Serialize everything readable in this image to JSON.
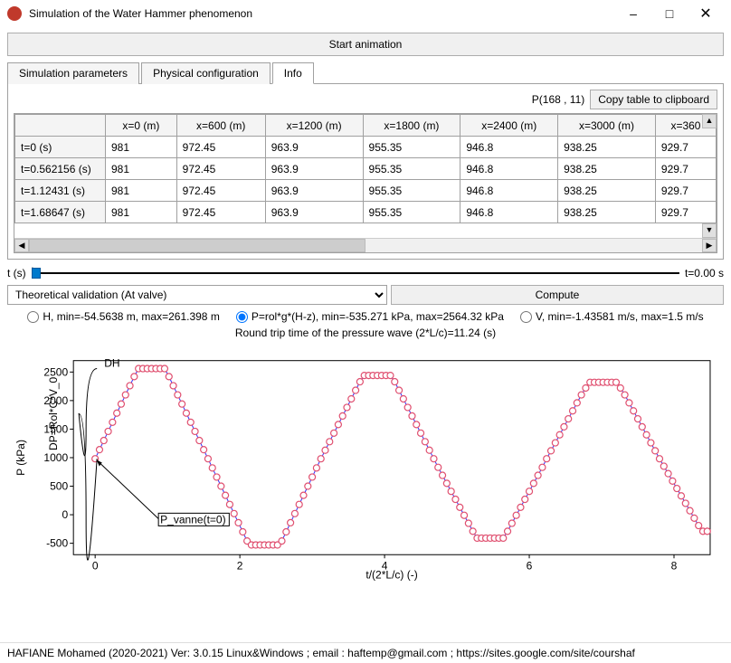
{
  "window": {
    "title": "Simulation of the Water Hammer phenomenon"
  },
  "start_button": "Start animation",
  "tabs": [
    {
      "label": "Simulation parameters"
    },
    {
      "label": "Physical configuration"
    },
    {
      "label": "Info"
    }
  ],
  "active_tab": 2,
  "info": {
    "pointer": "P(168 , 11)",
    "copy_button": "Copy table to clipboard",
    "table": {
      "col_headers": [
        "",
        "x=0 (m)",
        "x=600 (m)",
        "x=1200 (m)",
        "x=1800 (m)",
        "x=2400 (m)",
        "x=3000 (m)",
        "x=360"
      ],
      "row_headers": [
        "t=0 (s)",
        "t=0.562156 (s)",
        "t=1.12431 (s)",
        "t=1.68647 (s)"
      ],
      "cells": [
        [
          "981",
          "972.45",
          "963.9",
          "955.35",
          "946.8",
          "938.25",
          "929.7"
        ],
        [
          "981",
          "972.45",
          "963.9",
          "955.35",
          "946.8",
          "938.25",
          "929.7"
        ],
        [
          "981",
          "972.45",
          "963.9",
          "955.35",
          "946.8",
          "938.25",
          "929.7"
        ],
        [
          "981",
          "972.45",
          "963.9",
          "955.35",
          "946.8",
          "938.25",
          "929.7"
        ]
      ]
    }
  },
  "time": {
    "label": "t (s)",
    "value": "t=0.00 s"
  },
  "dropdown": {
    "selected": "Theoretical validation (At valve)"
  },
  "compute_button": "Compute",
  "radios": {
    "h": "H, min=-54.5638 m, max=261.398 m",
    "p": "P=rol*g*(H-z), min=-535.271 kPa, max=2564.32 kPa",
    "v": "V, min=-1.43581 m/s, max=1.5 m/s",
    "selected": "p"
  },
  "round_trip": "Round trip time of the pressure wave (2*L/c)=11.24 (s)",
  "chart_data": {
    "type": "line",
    "title": "",
    "xlabel": "t/(2*L/c) (-)",
    "ylabel": "P (kPa)",
    "xlim": [
      -0.3,
      8.5
    ],
    "ylim": [
      -700,
      2700
    ],
    "yticks": [
      -500,
      0,
      500,
      1000,
      1500,
      2000,
      2500
    ],
    "xticks": [
      0,
      2,
      4,
      6,
      8
    ],
    "annotations": {
      "dh": "DH",
      "dp": "DP=Rol*C*V_0",
      "p0": "P_vanne(t=0)"
    },
    "series": [
      {
        "name": "P",
        "color": "#3030ff",
        "x": [
          0.0,
          0.06,
          0.12,
          0.18,
          0.24,
          0.3,
          0.36,
          0.42,
          0.48,
          0.54,
          0.6,
          0.66,
          0.72,
          0.78,
          0.84,
          0.9,
          0.96,
          1.02,
          1.08,
          1.14,
          1.2,
          1.26,
          1.32,
          1.38,
          1.44,
          1.5,
          1.56,
          1.62,
          1.68,
          1.74,
          1.8,
          1.86,
          1.92,
          1.98,
          2.04,
          2.1,
          2.16,
          2.22,
          2.28,
          2.34,
          2.4,
          2.46,
          2.52,
          2.58,
          2.64,
          2.7,
          2.76,
          2.82,
          2.88,
          2.94,
          3.0,
          3.06,
          3.12,
          3.18,
          3.24,
          3.3,
          3.36,
          3.42,
          3.48,
          3.54,
          3.6,
          3.66,
          3.72,
          3.78,
          3.84,
          3.9,
          3.96,
          4.02,
          4.08,
          4.14,
          4.2,
          4.26,
          4.32,
          4.38,
          4.44,
          4.5,
          4.56,
          4.62,
          4.68,
          4.74,
          4.8,
          4.86,
          4.92,
          4.98,
          5.04,
          5.1,
          5.16,
          5.22,
          5.28,
          5.34,
          5.4,
          5.46,
          5.52,
          5.58,
          5.64,
          5.7,
          5.76,
          5.82,
          5.88,
          5.94,
          6.0,
          6.06,
          6.12,
          6.18,
          6.24,
          6.3,
          6.36,
          6.42,
          6.48,
          6.54,
          6.6,
          6.66,
          6.72,
          6.78,
          6.84,
          6.9,
          6.96,
          7.02,
          7.08,
          7.14,
          7.2,
          7.26,
          7.32,
          7.38,
          7.44,
          7.5,
          7.56,
          7.62,
          7.68,
          7.74,
          7.8,
          7.86,
          7.92,
          7.98,
          8.04,
          8.1,
          8.16,
          8.22,
          8.28,
          8.34,
          8.4,
          8.46
        ],
        "y": [
          981,
          1140,
          1300,
          1460,
          1620,
          1780,
          1940,
          2100,
          2260,
          2420,
          2560,
          2560,
          2560,
          2560,
          2560,
          2560,
          2560,
          2420,
          2260,
          2100,
          1940,
          1780,
          1620,
          1460,
          1300,
          1140,
          981,
          820,
          660,
          500,
          340,
          180,
          20,
          -140,
          -300,
          -460,
          -530,
          -530,
          -530,
          -530,
          -530,
          -530,
          -530,
          -460,
          -300,
          -140,
          20,
          180,
          340,
          500,
          660,
          820,
          981,
          1130,
          1280,
          1430,
          1580,
          1730,
          1880,
          2030,
          2180,
          2330,
          2440,
          2440,
          2440,
          2440,
          2440,
          2440,
          2440,
          2330,
          2180,
          2030,
          1880,
          1730,
          1580,
          1430,
          1280,
          1130,
          981,
          830,
          690,
          550,
          410,
          270,
          130,
          -10,
          -150,
          -290,
          -410,
          -410,
          -410,
          -410,
          -410,
          -410,
          -410,
          -290,
          -150,
          -10,
          130,
          270,
          410,
          550,
          690,
          830,
          981,
          1120,
          1260,
          1400,
          1540,
          1680,
          1820,
          1960,
          2100,
          2220,
          2320,
          2320,
          2320,
          2320,
          2320,
          2320,
          2320,
          2220,
          2100,
          1960,
          1820,
          1680,
          1540,
          1400,
          1260,
          1120,
          981,
          850,
          720,
          590,
          460,
          330,
          200,
          70,
          -60,
          -190,
          -290,
          -290
        ]
      }
    ]
  },
  "footer": "HAFIANE Mohamed (2020-2021) Ver: 3.0.15 Linux&Windows ; email : haftemp@gmail.com ; https://sites.google.com/site/courshaf"
}
